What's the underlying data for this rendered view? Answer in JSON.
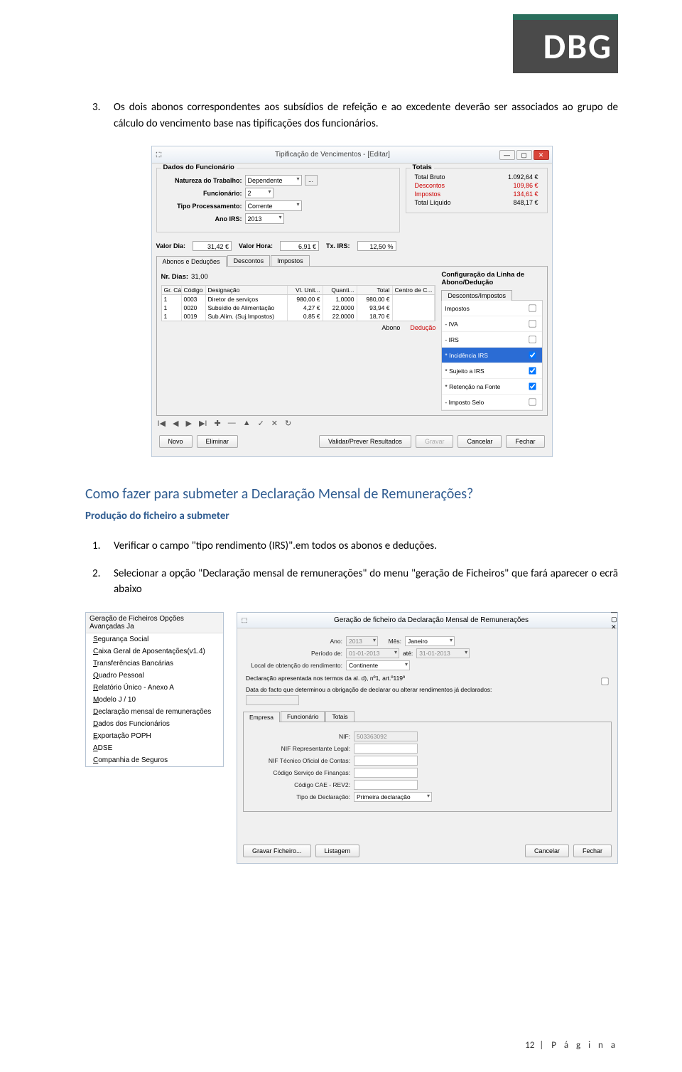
{
  "logo": "DBG",
  "para3_num": "3.",
  "para3_text": "Os dois abonos correspondentes aos subsídios de refeição e ao excedente deverão ser associados ao grupo de cálculo do vencimento base nas tipificações dos funcionários.",
  "screenshot1": {
    "title": "Tipificação de Vencimentos - [Editar]",
    "group_dados": "Dados do Funcionário",
    "group_totais": "Totais",
    "labels": {
      "natureza": "Natureza do Trabalho:",
      "funcionario": "Funcionário:",
      "tipo_proc": "Tipo Processamento:",
      "ano_irs": "Ano IRS:"
    },
    "values": {
      "natureza": "Dependente",
      "funcionario": "2",
      "tipo_proc": "Corrente",
      "ano_irs": "2013"
    },
    "totais": [
      {
        "n": "Total Bruto",
        "v": "1.092,64 €"
      },
      {
        "n": "Descontos",
        "v": "109,86 €"
      },
      {
        "n": "Impostos",
        "v": "134,61 €"
      },
      {
        "n": "Total Líquido",
        "v": "848,17 €"
      }
    ],
    "valrow": {
      "valordia_l": "Valor Dia:",
      "valordia": "31,42 €",
      "valorhora_l": "Valor Hora:",
      "valorhora": "6,91 €",
      "txirs_l": "Tx. IRS:",
      "txirs": "12,50 %"
    },
    "tabs": [
      "Abonos e Deduções",
      "Descontos",
      "Impostos"
    ],
    "nrdias_l": "Nr. Dias:",
    "nrdias": "31,00",
    "config_title": "Configuração da Linha de Abono/Dedução",
    "table_headers": [
      "Gr. Cá...",
      "Código",
      "Designação",
      "Vl. Unit...",
      "Quanti...",
      "Total",
      "Centro de C..."
    ],
    "table_rows": [
      [
        "1",
        "0003",
        "Diretor de serviços",
        "980,00 €",
        "1,0000",
        "980,00 €",
        ""
      ],
      [
        "1",
        "0020",
        "Subsídio de Alimentação",
        "4,27 €",
        "22,0000",
        "93,94 €",
        ""
      ],
      [
        "1",
        "0019",
        "Sub.Alim. (Suj.Impostos)",
        "0,85 €",
        "22,0000",
        "18,70 €",
        ""
      ]
    ],
    "desc_imp_tab": "Descontos/Impostos",
    "checks": [
      {
        "label": "Impostos",
        "chk": false,
        "hdr": true
      },
      {
        "label": "- IVA",
        "chk": false
      },
      {
        "label": "- IRS",
        "chk": false
      },
      {
        "label": "* Incidência IRS",
        "chk": true,
        "sel": true
      },
      {
        "label": "* Sujeito a IRS",
        "chk": true
      },
      {
        "label": "* Retenção na Fonte",
        "chk": true
      },
      {
        "label": "- Imposto Selo",
        "chk": false
      }
    ],
    "abono": "Abono",
    "deducao": "Dedução",
    "buttons": {
      "novo": "Novo",
      "eliminar": "Eliminar",
      "validar": "Validar/Prever Resultados",
      "gravar": "Gravar",
      "cancelar": "Cancelar",
      "fechar": "Fechar"
    }
  },
  "heading2": "Como fazer para submeter a Declaração Mensal de Remunerações?",
  "subheading": "Produção do ficheiro a submeter",
  "step1_num": "1.",
  "step1_text": "Verificar o campo \"tipo rendimento (IRS)\".em todos os abonos e deduções.",
  "step2_num": "2.",
  "step2_text": "Selecionar a opção \"Declaração mensal de remunerações\" do menu \"geração de Ficheiros\" que fará aparecer o ecrã abaixo",
  "screenshot2": {
    "menubar": "Geração de Ficheiros   Opções Avançadas   Ja",
    "items": [
      "Segurança Social",
      "Caixa Geral de Aposentações(v1.4)",
      "Transferências Bancárias",
      "Quadro Pessoal",
      "Relatório Único - Anexo A",
      "Modelo J / 10",
      "Declaração mensal de remunerações",
      "Dados dos Funcionários",
      "Exportação POPH",
      "ADSE",
      "Companhia de Seguros"
    ]
  },
  "screenshot3": {
    "title": "Geração de ficheiro da Declaração Mensal de Remunerações",
    "labels": {
      "ano": "Ano:",
      "ano_v": "2013",
      "mes": "Mês:",
      "mes_v": "Janeiro",
      "periodo": "Período de:",
      "de_v": "01-01-2013",
      "ate": "até:",
      "ate_v": "31-01-2013",
      "local": "Local de obtenção do rendimento:",
      "local_v": "Continente",
      "decl_text": "Declaração apresentada nos termos da al. d), nº1, art.º119º",
      "data_facto": "Data do facto que determinou a obrigação de declarar ou alterar rendimentos já declarados:",
      "nif": "NIF:",
      "nif_v": "503363092",
      "nif_rep": "NIF Representante Legal:",
      "nif_toc": "NIF Técnico Oficial de Contas:",
      "cod_serv": "Código Serviço de Finanças:",
      "cod_cae": "Código CAE - REV2:",
      "tipo_decl": "Tipo de Declaração:",
      "tipo_decl_v": "Primeira declaração"
    },
    "tabs": [
      "Empresa",
      "Funcionário",
      "Totais"
    ],
    "buttons": {
      "gravar": "Gravar Ficheiro...",
      "listagem": "Listagem",
      "cancelar": "Cancelar",
      "fechar": "Fechar"
    }
  },
  "footer": {
    "page": "12",
    "label": "P á g i n a"
  }
}
